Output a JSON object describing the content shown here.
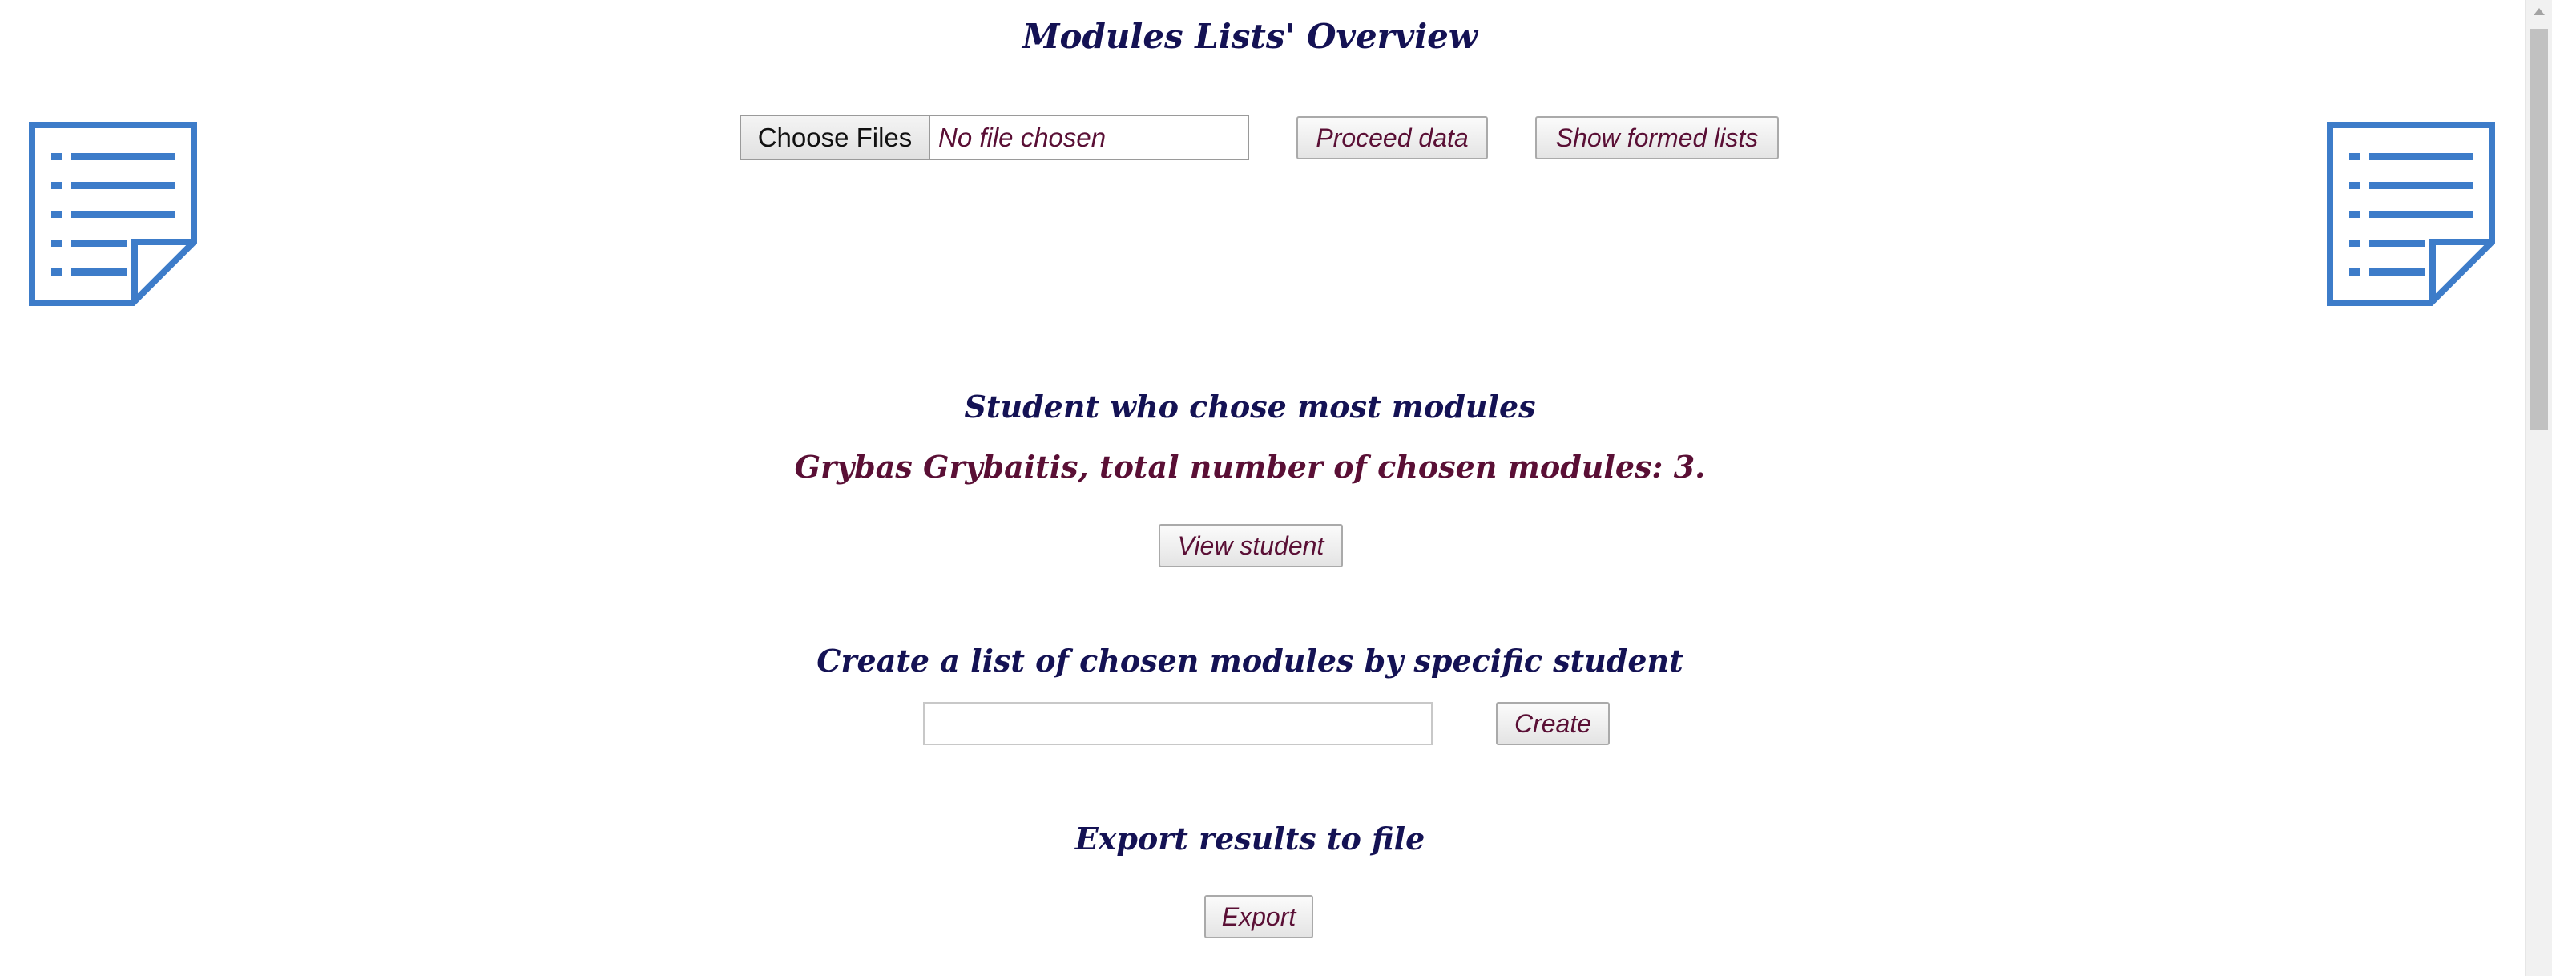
{
  "page": {
    "title": "Modules Lists' Overview"
  },
  "upload": {
    "choose_files_label": "Choose Files",
    "file_status": "No file chosen",
    "proceed_label": "Proceed data",
    "show_lists_label": "Show formed lists"
  },
  "most_modules": {
    "heading": "Student who chose most modules",
    "result": "Grybas Grybaitis, total number of chosen modules: 3.",
    "view_label": "View student"
  },
  "create_list": {
    "heading": "Create a list of chosen modules by specific student",
    "input_value": "",
    "input_placeholder": "",
    "create_label": "Create"
  },
  "export": {
    "heading": "Export results to file",
    "export_label": "Export"
  },
  "icons": {
    "left": "document-list-icon",
    "right": "document-list-icon"
  },
  "colors": {
    "heading": "#141254",
    "accent_text": "#5a0f35",
    "icon_blue": "#3d7cc9"
  }
}
